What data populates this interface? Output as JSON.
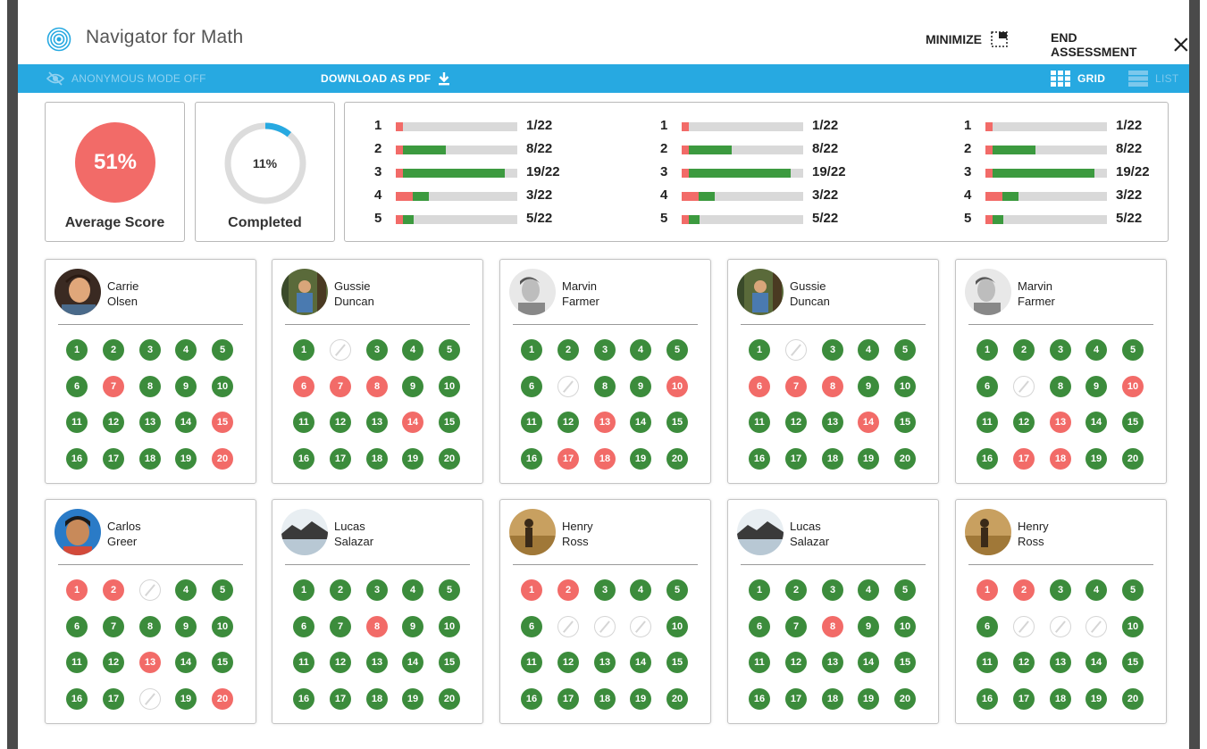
{
  "header": {
    "title": "Navigator for Math",
    "minimize_label": "MINIMIZE",
    "end_label": "END ASSESSMENT"
  },
  "toolbar": {
    "anonymous_label": "ANONYMOUS MODE OFF",
    "download_label": "DOWNLOAD AS PDF",
    "grid_label": "GRID",
    "list_label": "LIST"
  },
  "summary": {
    "average_score": "51%",
    "average_label": "Average Score",
    "completed_pct": "11%",
    "completed_fraction": 0.11,
    "completed_label": "Completed"
  },
  "question_columns": [
    [
      {
        "num": "1",
        "frac": "1/22",
        "incorrect": 1,
        "correct": 0
      },
      {
        "num": "2",
        "frac": "8/22",
        "incorrect": 1,
        "correct": 8
      },
      {
        "num": "3",
        "frac": "19/22",
        "incorrect": 1,
        "correct": 19
      },
      {
        "num": "4",
        "frac": "3/22",
        "incorrect": 3,
        "correct": 3
      },
      {
        "num": "5",
        "frac": "5/22",
        "incorrect": 1,
        "correct": 2
      }
    ],
    [
      {
        "num": "1",
        "frac": "1/22",
        "incorrect": 1,
        "correct": 0
      },
      {
        "num": "2",
        "frac": "8/22",
        "incorrect": 1,
        "correct": 8
      },
      {
        "num": "3",
        "frac": "19/22",
        "incorrect": 1,
        "correct": 19
      },
      {
        "num": "4",
        "frac": "3/22",
        "incorrect": 3,
        "correct": 3
      },
      {
        "num": "5",
        "frac": "5/22",
        "incorrect": 1,
        "correct": 2
      }
    ],
    [
      {
        "num": "1",
        "frac": "1/22",
        "incorrect": 1,
        "correct": 0
      },
      {
        "num": "2",
        "frac": "8/22",
        "incorrect": 1,
        "correct": 8
      },
      {
        "num": "3",
        "frac": "19/22",
        "incorrect": 1,
        "correct": 19
      },
      {
        "num": "4",
        "frac": "3/22",
        "incorrect": 3,
        "correct": 3
      },
      {
        "num": "5",
        "frac": "5/22",
        "incorrect": 1,
        "correct": 2
      }
    ]
  ],
  "colors": {
    "accent": "#27a9e1",
    "correct": "#3c8c3c",
    "incorrect": "#f26b68",
    "track": "#d9d9d9"
  },
  "students": [
    {
      "first": "Carrie",
      "last": "Olsen",
      "avatar": "child-portrait-dark",
      "results": [
        "c",
        "c",
        "c",
        "c",
        "c",
        "c",
        "i",
        "c",
        "c",
        "c",
        "c",
        "c",
        "c",
        "c",
        "i",
        "c",
        "c",
        "c",
        "c",
        "i"
      ]
    },
    {
      "first": "Gussie",
      "last": "Duncan",
      "avatar": "person-in-forest",
      "results": [
        "c",
        "s",
        "c",
        "c",
        "c",
        "i",
        "i",
        "i",
        "c",
        "c",
        "c",
        "c",
        "c",
        "i",
        "c",
        "c",
        "c",
        "c",
        "c",
        "c"
      ]
    },
    {
      "first": "Marvin",
      "last": "Farmer",
      "avatar": "child-portrait-grey",
      "results": [
        "c",
        "c",
        "c",
        "c",
        "c",
        "c",
        "s",
        "c",
        "c",
        "i",
        "c",
        "c",
        "i",
        "c",
        "c",
        "c",
        "i",
        "i",
        "c",
        "c"
      ]
    },
    {
      "first": "Gussie",
      "last": "Duncan",
      "avatar": "person-in-forest",
      "results": [
        "c",
        "s",
        "c",
        "c",
        "c",
        "i",
        "i",
        "i",
        "c",
        "c",
        "c",
        "c",
        "c",
        "i",
        "c",
        "c",
        "c",
        "c",
        "c",
        "c"
      ]
    },
    {
      "first": "Marvin",
      "last": "Farmer",
      "avatar": "child-portrait-grey",
      "results": [
        "c",
        "c",
        "c",
        "c",
        "c",
        "c",
        "s",
        "c",
        "c",
        "i",
        "c",
        "c",
        "i",
        "c",
        "c",
        "c",
        "i",
        "i",
        "c",
        "c"
      ]
    },
    {
      "first": "Carlos",
      "last": "Greer",
      "avatar": "boy-portrait-blue",
      "results": [
        "i",
        "i",
        "s",
        "c",
        "c",
        "c",
        "c",
        "c",
        "c",
        "c",
        "c",
        "c",
        "i",
        "c",
        "c",
        "c",
        "c",
        "s",
        "c",
        "i"
      ]
    },
    {
      "first": "Lucas",
      "last": "Salazar",
      "avatar": "landscape-lake",
      "results": [
        "c",
        "c",
        "c",
        "c",
        "c",
        "c",
        "c",
        "i",
        "c",
        "c",
        "c",
        "c",
        "c",
        "c",
        "c",
        "c",
        "c",
        "c",
        "c",
        "c"
      ]
    },
    {
      "first": "Henry",
      "last": "Ross",
      "avatar": "silhouette-sunset",
      "results": [
        "i",
        "i",
        "c",
        "c",
        "c",
        "c",
        "s",
        "s",
        "s",
        "c",
        "c",
        "c",
        "c",
        "c",
        "c",
        "c",
        "c",
        "c",
        "c",
        "c"
      ]
    },
    {
      "first": "Lucas",
      "last": "Salazar",
      "avatar": "landscape-lake",
      "results": [
        "c",
        "c",
        "c",
        "c",
        "c",
        "c",
        "c",
        "i",
        "c",
        "c",
        "c",
        "c",
        "c",
        "c",
        "c",
        "c",
        "c",
        "c",
        "c",
        "c"
      ]
    },
    {
      "first": "Henry",
      "last": "Ross",
      "avatar": "silhouette-sunset",
      "results": [
        "i",
        "i",
        "c",
        "c",
        "c",
        "c",
        "s",
        "s",
        "s",
        "c",
        "c",
        "c",
        "c",
        "c",
        "c",
        "c",
        "c",
        "c",
        "c",
        "c"
      ]
    }
  ]
}
